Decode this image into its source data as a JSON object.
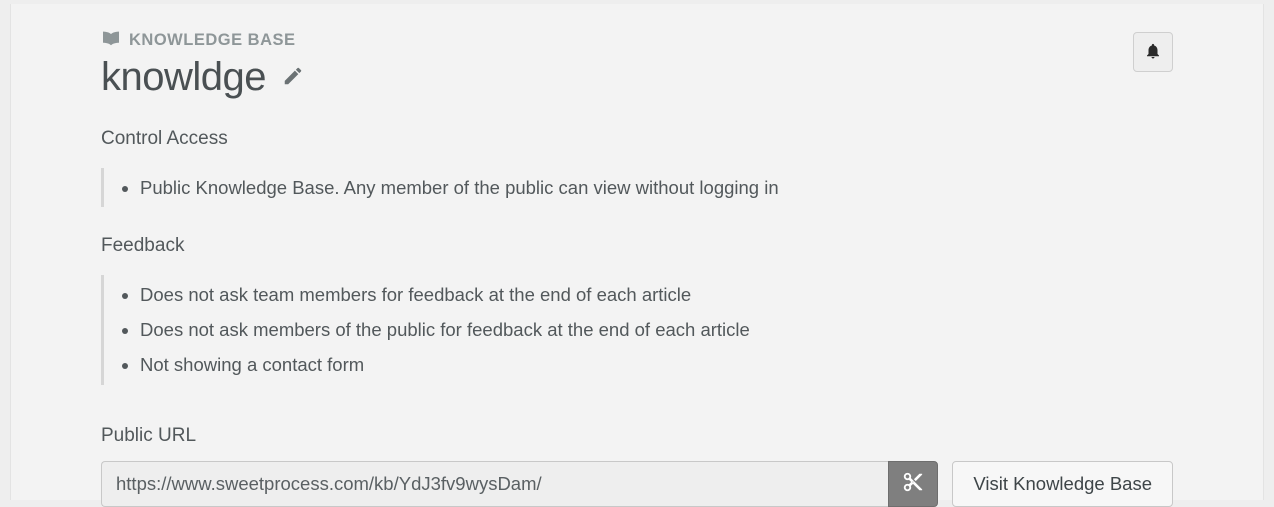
{
  "breadcrumb": {
    "label": "KNOWLEDGE BASE"
  },
  "page": {
    "title": "knowldge"
  },
  "sections": {
    "access": {
      "heading": "Control Access",
      "items": [
        "Public Knowledge Base. Any member of the public can view without logging in"
      ]
    },
    "feedback": {
      "heading": "Feedback",
      "items": [
        "Does not ask team members for feedback at the end of each article",
        "Does not ask members of the public for feedback at the end of each article",
        "Not showing a contact form"
      ]
    },
    "public_url": {
      "heading": "Public URL",
      "value": "https://www.sweetprocess.com/kb/YdJ3fv9wysDam/",
      "visit_label": "Visit Knowledge Base"
    }
  }
}
